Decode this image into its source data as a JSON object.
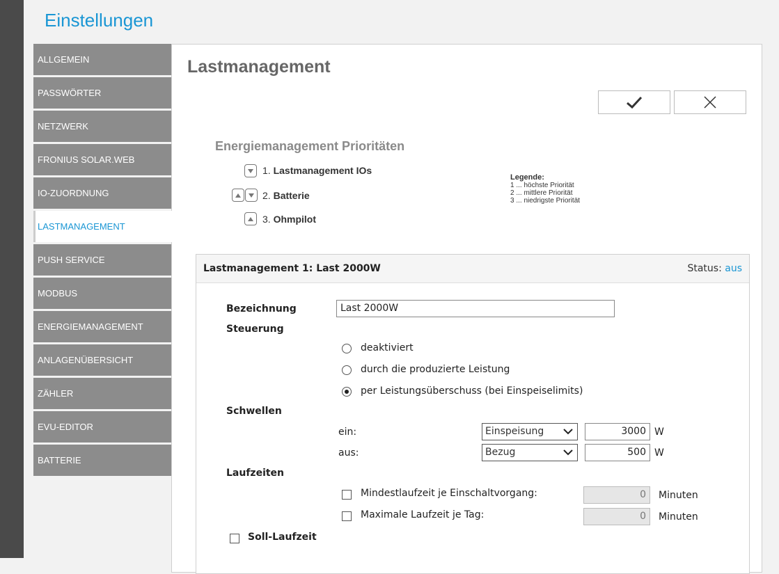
{
  "app": {
    "title": "Einstellungen"
  },
  "sidebar": {
    "items": [
      {
        "label": "ALLGEMEIN"
      },
      {
        "label": "PASSWÖRTER"
      },
      {
        "label": "NETZWERK"
      },
      {
        "label": "FRONIUS SOLAR.WEB"
      },
      {
        "label": "IO-ZUORDNUNG"
      },
      {
        "label": "LASTMANAGEMENT",
        "active": true
      },
      {
        "label": "PUSH SERVICE"
      },
      {
        "label": "MODBUS"
      },
      {
        "label": "ENERGIEMANAGEMENT"
      },
      {
        "label": "ANLAGENÜBERSICHT"
      },
      {
        "label": "ZÄHLER"
      },
      {
        "label": "EVU-EDITOR"
      },
      {
        "label": "BATTERIE"
      }
    ]
  },
  "page": {
    "title": "Lastmanagement",
    "confirm_icon": "checkmark-icon",
    "cancel_icon": "close-icon"
  },
  "priorities": {
    "title": "Energiemanagement Prioritäten",
    "items": [
      {
        "number": "1.",
        "label": "Lastmanagement IOs"
      },
      {
        "number": "2.",
        "label": "Batterie"
      },
      {
        "number": "3.",
        "label": "Ohmpilot"
      }
    ],
    "legend": {
      "title": "Legende:",
      "lines": [
        "1 ... höchste Priorität",
        "2 ... mittlere Priorität",
        "3 ... niedrigste Priorität"
      ]
    }
  },
  "card": {
    "title": "Lastmanagement 1: Last 2000W",
    "status_label": "Status:",
    "status_value": "aus",
    "bezeichnung_label": "Bezeichnung",
    "bezeichnung_value": "Last 2000W",
    "steuerung_label": "Steuerung",
    "steuerung_options": [
      {
        "label": "deaktiviert",
        "selected": false
      },
      {
        "label": "durch die produzierte Leistung",
        "selected": false
      },
      {
        "label": "per Leistungsüberschuss (bei Einspeiselimits)",
        "selected": true
      }
    ],
    "schwellen_label": "Schwellen",
    "schwellen": [
      {
        "label": "ein:",
        "mode": "Einspeisung",
        "value": "3000",
        "unit": "W"
      },
      {
        "label": "aus:",
        "mode": "Bezug",
        "value": "500",
        "unit": "W"
      }
    ],
    "laufzeiten_label": "Laufzeiten",
    "laufzeiten": [
      {
        "label": "Mindestlaufzeit je Einschaltvorgang:",
        "checked": false,
        "value": "0",
        "unit": "Minuten"
      },
      {
        "label": "Maximale Laufzeit je Tag:",
        "checked": false,
        "value": "0",
        "unit": "Minuten"
      }
    ],
    "soll_laufzeit_label": "Soll-Laufzeit",
    "soll_laufzeit_checked": false
  },
  "colors": {
    "accent": "#1a96d4",
    "sidebar_bg": "#8c8c8c",
    "leftbar": "#4a4a4a"
  }
}
